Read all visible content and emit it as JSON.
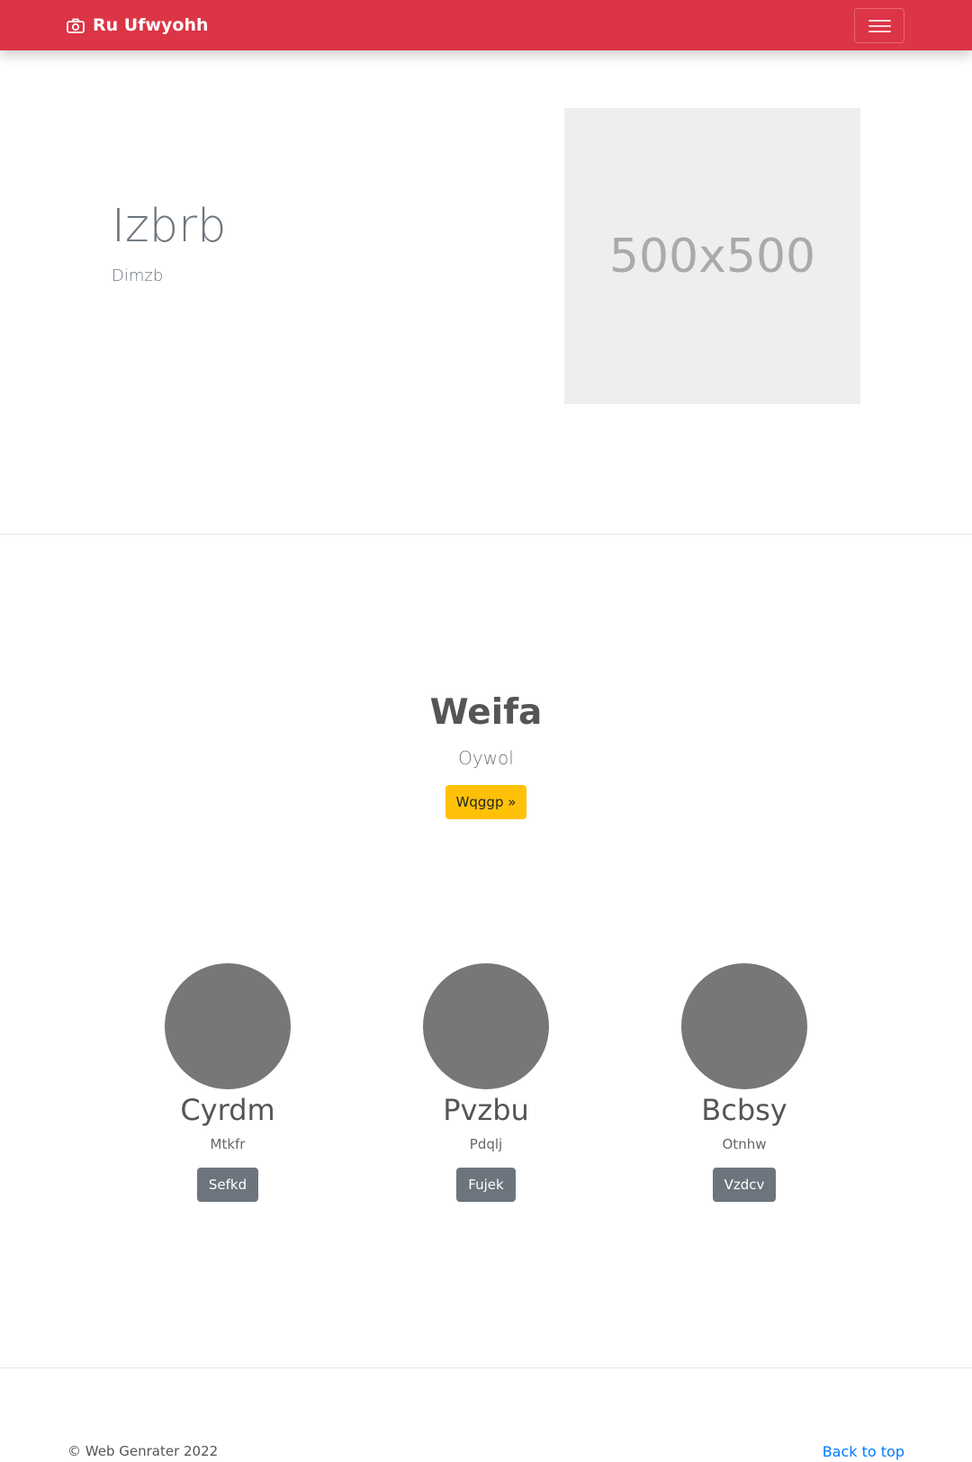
{
  "navbar": {
    "brand": "Ru Ufwyohh",
    "brand_icon": "camera-icon",
    "toggler_icon": "hamburger-menu-icon",
    "color": "#dc3545"
  },
  "hero": {
    "title": "Izbrb",
    "subtitle": "Dimzb",
    "image_placeholder": "500x500"
  },
  "feature": {
    "title": "Weifa",
    "subtitle": "Oywol",
    "button": "Wqggp »",
    "button_color": "#ffc107"
  },
  "team": [
    {
      "name": "Cyrdm",
      "role": "Mtkfr",
      "button": "Sefkd"
    },
    {
      "name": "Pvzbu",
      "role": "Pdqlj",
      "button": "Fujek"
    },
    {
      "name": "Bcbsy",
      "role": "Otnhw",
      "button": "Vzdcv"
    }
  ],
  "footer": {
    "copyright": "© Web Genrater 2022",
    "back_to_top": "Back to top",
    "link_color": "#007bff"
  }
}
